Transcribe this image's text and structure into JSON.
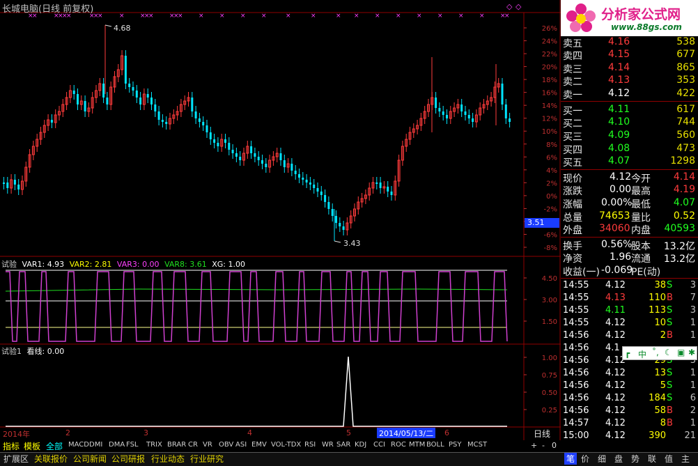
{
  "window": {
    "title": "长城电脑(日线 前复权)"
  },
  "logo": {
    "name": "分析家公式网",
    "url": "www.88gs.com"
  },
  "main_chart": {
    "high_label": "4.68",
    "low_label": "3.43",
    "current_price_tag": "3.51",
    "pct_axis": [
      "26%",
      "24%",
      "22%",
      "20%",
      "18%",
      "16%",
      "14%",
      "12%",
      "10%",
      "8%",
      "6%",
      "4%",
      "2%",
      "0%",
      "-2%",
      "-4%",
      "-6%",
      "-8%"
    ]
  },
  "indicator1": {
    "name": "试验",
    "var1": "VAR1: 4.93",
    "var2": "VAR2: 2.81",
    "var3": "VAR3: 0.00",
    "var8": "VAR8: 3.61",
    "xg": "XG: 1.00",
    "axis": [
      "4.50",
      "3.00",
      "1.50"
    ]
  },
  "indicator2": {
    "name": "试验1",
    "kanxian": "看线: 0.00",
    "axis": [
      "1.00",
      "0.75",
      "0.50",
      "0.25"
    ]
  },
  "time_axis": {
    "labels": [
      "2014年",
      "2",
      "3",
      "4",
      "5",
      "6"
    ],
    "cursor_date": "2014/05/13/二",
    "period_label": "日线"
  },
  "order_book": {
    "asks": [
      {
        "label": "卖五",
        "price": "4.16",
        "vol": "538"
      },
      {
        "label": "卖四",
        "price": "4.15",
        "vol": "677"
      },
      {
        "label": "卖三",
        "price": "4.14",
        "vol": "865"
      },
      {
        "label": "卖二",
        "price": "4.13",
        "vol": "353"
      },
      {
        "label": "卖一",
        "price": "4.12",
        "vol": "422"
      }
    ],
    "bids": [
      {
        "label": "买一",
        "price": "4.11",
        "vol": "617"
      },
      {
        "label": "买二",
        "price": "4.10",
        "vol": "744"
      },
      {
        "label": "买三",
        "price": "4.09",
        "vol": "560"
      },
      {
        "label": "买四",
        "price": "4.08",
        "vol": "473"
      },
      {
        "label": "买五",
        "price": "4.07",
        "vol": "1298"
      }
    ]
  },
  "stats": {
    "xianjia_l": "现价",
    "xianjia": "4.12",
    "jinkai_l": "今开",
    "jinkai": "4.14",
    "zhangdie_l": "涨跌",
    "zhangdie": "0.00",
    "zuigao_l": "最高",
    "zuigao": "4.19",
    "zhangfu_l": "涨幅",
    "zhangfu": "0.00%",
    "zuidi_l": "最低",
    "zuidi": "4.07",
    "zongliang_l": "总量",
    "zongliang": "74653",
    "liangbi_l": "量比",
    "liangbi": "0.52",
    "waipan_l": "外盘",
    "waipan": "34060",
    "neipan_l": "内盘",
    "neipan": "40593",
    "huanshou_l": "换手",
    "huanshou": "0.56%",
    "guben_l": "股本",
    "guben": "13.2亿",
    "jingzi_l": "净资",
    "jingzi": "1.96",
    "liutong_l": "流通",
    "liutong": "13.2亿",
    "shouyi_l": "收益(一)",
    "shouyi": "-0.069",
    "pe_l": "PE(动)",
    "pe": ""
  },
  "ticks": [
    {
      "time": "14:55",
      "price": "4.12",
      "vol": "38",
      "side": "S",
      "n": "3"
    },
    {
      "time": "14:55",
      "price": "4.13",
      "vol": "110",
      "side": "B",
      "n": "7"
    },
    {
      "time": "14:55",
      "price": "4.11",
      "vol": "113",
      "side": "S",
      "n": "3"
    },
    {
      "time": "14:55",
      "price": "4.12",
      "vol": "10",
      "side": "S",
      "n": "1"
    },
    {
      "time": "14:56",
      "price": "4.12",
      "vol": "2",
      "side": "B",
      "n": "1"
    },
    {
      "time": "14:56",
      "price": "4.1",
      "vol": "",
      "side": "",
      "n": ""
    },
    {
      "time": "14:56",
      "price": "4.12",
      "vol": "29",
      "side": "S",
      "n": "3"
    },
    {
      "time": "14:56",
      "price": "4.12",
      "vol": "13",
      "side": "S",
      "n": "1"
    },
    {
      "time": "14:56",
      "price": "4.12",
      "vol": "5",
      "side": "S",
      "n": "1"
    },
    {
      "time": "14:56",
      "price": "4.12",
      "vol": "184",
      "side": "S",
      "n": "6"
    },
    {
      "time": "14:56",
      "price": "4.12",
      "vol": "58",
      "side": "B",
      "n": "2"
    },
    {
      "time": "14:57",
      "price": "4.12",
      "vol": "8",
      "side": "B",
      "n": "1"
    },
    {
      "time": "15:00",
      "price": "4.12",
      "vol": "390",
      "side": "",
      "n": "21"
    }
  ],
  "ime_bar": {
    "text": "中"
  },
  "indicator_tabs": [
    "指标",
    "模板",
    "全部",
    "MACD",
    "DMI",
    "DMA",
    "FSL",
    "TRIX",
    "BRAR",
    "CR",
    "VR",
    "OBV",
    "ASI",
    "EMV",
    "VOL-TDX",
    "RSI",
    "WR",
    "SAR",
    "KDJ",
    "CCI",
    "ROC",
    "MTM",
    "BOLL",
    "PSY",
    "MCST"
  ],
  "zoom_buttons": [
    "+",
    "-",
    "0"
  ],
  "bottom_tabs": [
    "扩展区",
    "关联报价",
    "公司新闻",
    "公司研报",
    "行业动态",
    "行业研究"
  ],
  "right_tabs": [
    "笔",
    "价",
    "细",
    "盘",
    "势",
    "联",
    "值",
    "主"
  ],
  "colors": {
    "up": "#ff3b3b",
    "down": "#00e5ff",
    "accent": "#d040d0"
  }
}
